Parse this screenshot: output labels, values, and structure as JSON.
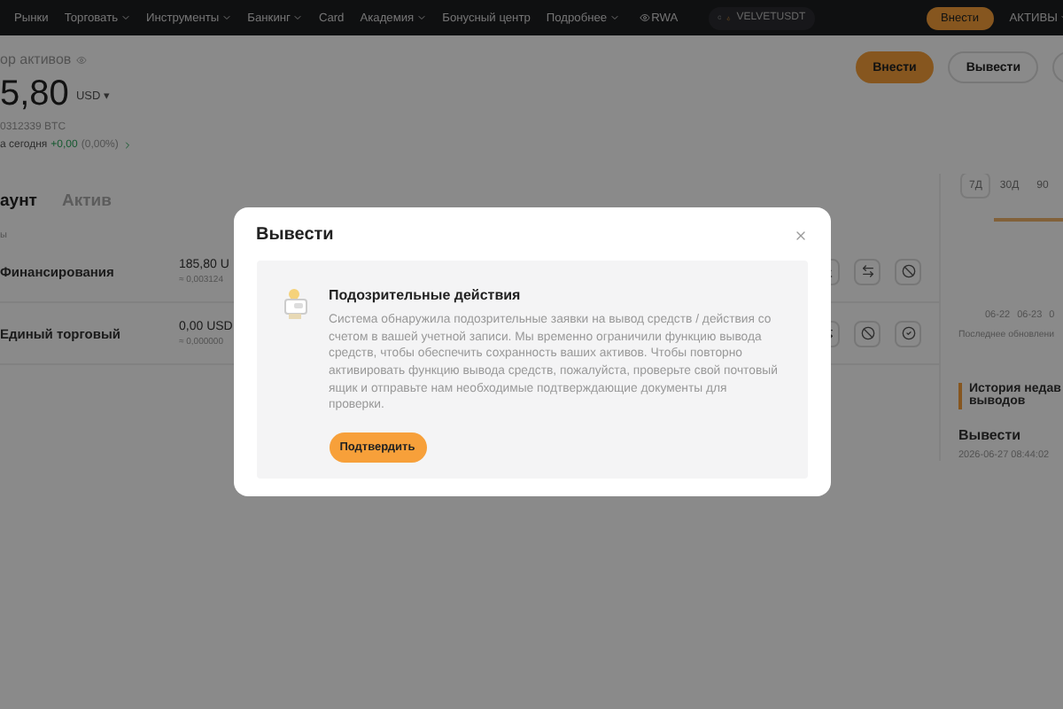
{
  "nav": {
    "items": [
      {
        "label": "Рынки",
        "dropdown": false
      },
      {
        "label": "Торговать",
        "dropdown": true
      },
      {
        "label": "Инструменты",
        "dropdown": true
      },
      {
        "label": "Банкинг",
        "dropdown": true
      },
      {
        "label": "Card",
        "dropdown": false
      },
      {
        "label": "Академия",
        "dropdown": true
      },
      {
        "label": "Бонусный центр",
        "dropdown": false
      },
      {
        "label": "Подробнее",
        "dropdown": true
      }
    ],
    "rwa": "RWA",
    "search": "VELVETUSDT",
    "deposit": "Внести",
    "assets": "АКТИВЫ"
  },
  "overview": {
    "title": "ор активов",
    "amount": "5,80",
    "currency": "USD",
    "currency_caret": "▾",
    "btc": "0312339 BTC",
    "today_label": "а сегодня",
    "today_change": "+0,00",
    "today_percent": "(0,00%)"
  },
  "actions": [
    "Внести",
    "Вывести"
  ],
  "tabs": [
    {
      "label": "аунт",
      "selected": true
    },
    {
      "label": "Актив",
      "selected": false
    }
  ],
  "accounts": {
    "section_label": "ы",
    "rows": [
      {
        "name": "Финансирования",
        "amount": "185,80 U",
        "approx": "≈ 0,003124"
      },
      {
        "name": "Единый торговый",
        "amount": "0,00 USD",
        "approx": "≈ 0,000000"
      }
    ]
  },
  "chart": {
    "periods": [
      {
        "label": "7Д",
        "selected": true
      },
      {
        "label": "30Д",
        "selected": false
      },
      {
        "label": "90",
        "selected": false
      }
    ],
    "dates": [
      "06-22",
      "06-23",
      "0"
    ],
    "updated": "Последнее обновлени"
  },
  "history": {
    "title_lines": [
      "История недав",
      "выводов"
    ],
    "item_title": "Вывести",
    "item_time": "2026-06-27 08:44:02"
  },
  "modal": {
    "title": "Вывести",
    "heading": "Подозрительные действия",
    "text": "Система обнаружила подозрительные заявки на вывод средств / действия со счетом в вашей учетной записи. Мы временно ограничили функцию вывода средств, чтобы обеспечить сохранность ваших активов. Чтобы повторно активировать функцию вывода средств, пожалуйста, проверьте свой почтовый ящик и отправьте нам необходимые подтверждающие документы для проверки.",
    "button": "Подтвердить"
  }
}
